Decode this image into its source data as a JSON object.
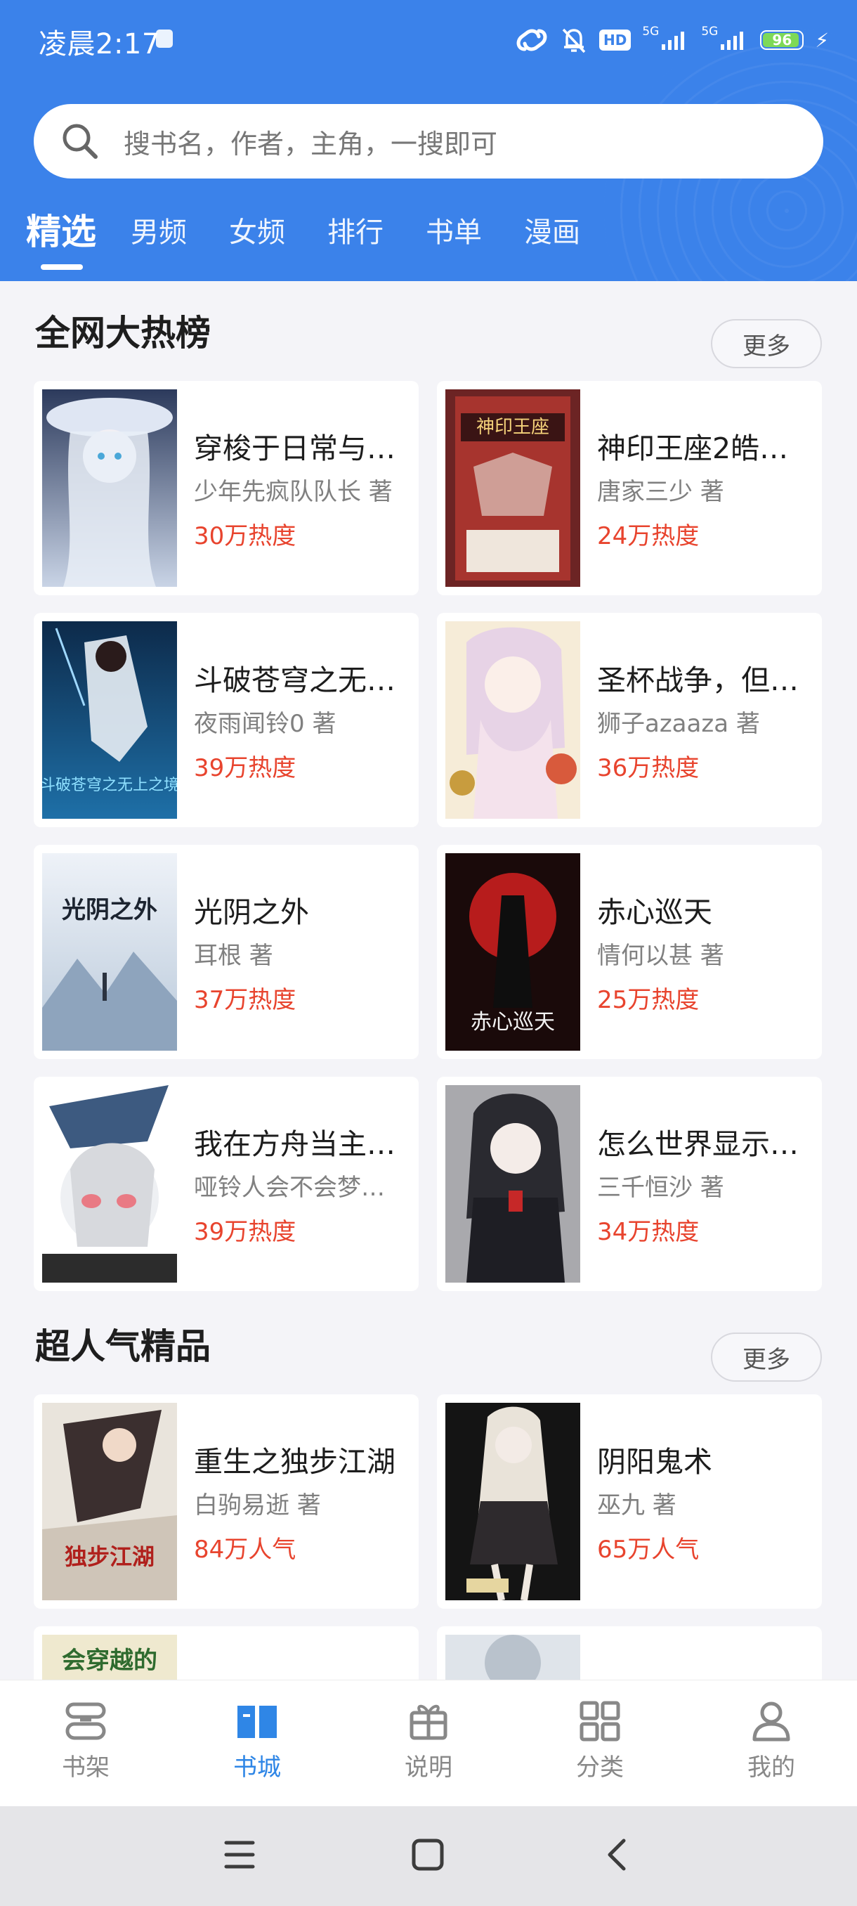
{
  "status_bar": {
    "time": "凌晨2:17",
    "hd_label": "HD",
    "network_1": "5G",
    "network_2": "5G",
    "battery": "96",
    "battery_level": 0.96
  },
  "search": {
    "placeholder": "搜书名，作者，主角，一搜即可"
  },
  "tabs": [
    {
      "label": "精选"
    },
    {
      "label": "男频"
    },
    {
      "label": "女频"
    },
    {
      "label": "排行"
    },
    {
      "label": "书单"
    },
    {
      "label": "漫画"
    }
  ],
  "section_hot": {
    "title": "全网大热榜",
    "more_label": "更多",
    "books": [
      {
        "title": "穿梭于日常与…",
        "author": "少年先疯队队长 著",
        "heat": "30万热度"
      },
      {
        "title": "神印王座2皓…",
        "author": "唐家三少 著",
        "heat": "24万热度"
      },
      {
        "title": "斗破苍穹之无…",
        "author": "夜雨闻铃0 著",
        "heat": "39万热度"
      },
      {
        "title": "圣杯战争，但…",
        "author": "狮子azaaza 著",
        "heat": "36万热度"
      },
      {
        "title": "光阴之外",
        "author": "耳根 著",
        "heat": "37万热度"
      },
      {
        "title": "赤心巡天",
        "author": "情何以甚 著",
        "heat": "25万热度"
      },
      {
        "title": "我在方舟当主…",
        "author": "哑铃人会不会梦…",
        "heat": "39万热度"
      },
      {
        "title": "怎么世界显示…",
        "author": "三千恒沙 著",
        "heat": "34万热度"
      }
    ]
  },
  "section_popular": {
    "title": "超人气精品",
    "more_label": "更多",
    "books": [
      {
        "title": "重生之独步江湖",
        "author": "白驹易逝 著",
        "heat": "84万人气"
      },
      {
        "title": "阴阳鬼术",
        "author": "巫九 著",
        "heat": "65万人气"
      }
    ]
  },
  "covers": {
    "c1_text": "",
    "c2_text": "神印王座",
    "c3_text": "斗破苍穹之无上之境",
    "c5_text": "光阴之外",
    "c6_text": "赤心巡天",
    "c9_text": "独步江湖",
    "c11_text": "会穿越的"
  },
  "bottom_nav": [
    {
      "label": "书架",
      "icon": "bookshelf-icon"
    },
    {
      "label": "书城",
      "icon": "book-open-icon"
    },
    {
      "label": "说明",
      "icon": "gift-icon"
    },
    {
      "label": "分类",
      "icon": "grid-icon"
    },
    {
      "label": "我的",
      "icon": "user-icon"
    }
  ],
  "colors": {
    "header_blue": "#3b82ea",
    "heat_red": "#e8442e",
    "nav_active": "#2f86e6"
  }
}
